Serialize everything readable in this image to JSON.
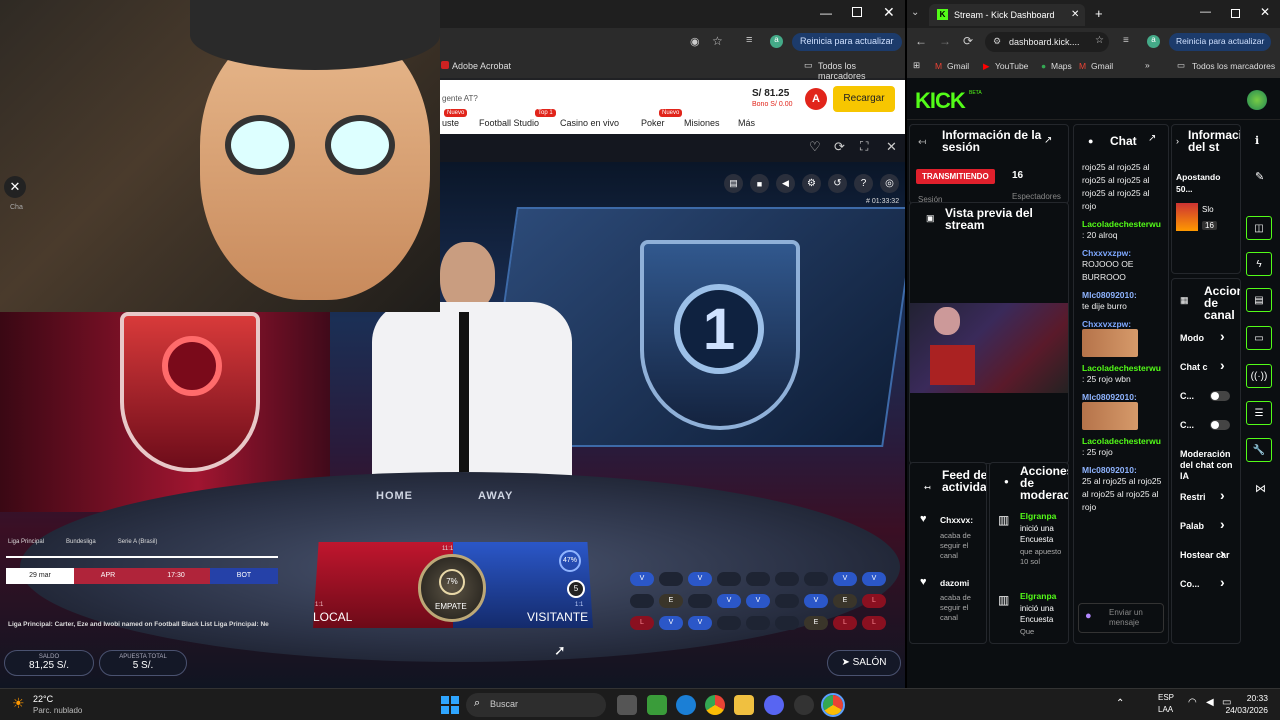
{
  "left_browser": {
    "bookmark": "Adobe Acrobat",
    "all_bookmarks": "Todos los marcadores",
    "restart_label": "Reinicia para actualizar",
    "site": {
      "balance": "S/ 81.25",
      "bonus": "Bono S/ 0.00",
      "avatar_letter": "A",
      "recharge": "Recargar",
      "partial_text": "gente AT?",
      "nav": [
        {
          "label": "Football Studio",
          "badge": "Top 1"
        },
        {
          "label": "Casino en vivo",
          "badge": ""
        },
        {
          "label": "Poker",
          "badge": "Nuevo"
        },
        {
          "label": "Misiones",
          "badge": ""
        },
        {
          "label": "Más",
          "badge": ""
        }
      ],
      "nav_badge_left": "Nuevo",
      "left_fragment": "uste"
    },
    "game": {
      "timer": "# 01:33:32",
      "desk_home": "HOME",
      "desk_away": "AWAY",
      "leagues": [
        "Liga Principal",
        "Bundesliga",
        "Serie A (Brasil)"
      ],
      "date_cells": [
        "29 mar",
        "APR",
        "17:30",
        "BOT"
      ],
      "local": "LOCAL",
      "visitante": "VISITANTE",
      "empate": "EMPATE",
      "empate_pct": "7%",
      "visit_pct": "47%",
      "local_ratio": "1:1",
      "visit_ratio": "1:1",
      "tie_ratio": "11:1",
      "ticker": "Liga Principal: Carter, Eze and Iwobi named on Football Black List   Liga Principal: Ne",
      "saldo_label": "SALDO",
      "saldo": "81,25 S/.",
      "apuesta_label": "APUESTA TOTAL",
      "apuesta": "5 S/.",
      "salon": "SALÓN",
      "history": [
        [
          "V",
          "",
          "V",
          "",
          "",
          "",
          "",
          "V",
          "V"
        ],
        [
          "",
          "E",
          "",
          "V",
          "V",
          "",
          "V",
          "E",
          "L"
        ],
        [
          "L",
          "V",
          "V",
          "",
          "",
          "",
          "E",
          "L",
          "L"
        ]
      ]
    }
  },
  "webcam": {
    "partial_tab": "Cha"
  },
  "right_browser": {
    "tab_title": "Stream - Kick Dashboard",
    "url": "dashboard.kick....",
    "restart_label": "Reinicia para actualizar",
    "bookmarks": [
      "Gmail",
      "YouTube",
      "Maps",
      "Gmail"
    ],
    "all_bookmarks": "Todos los marcadores",
    "logo": "KICK",
    "logo_sup": "BETA",
    "session": {
      "title": "Información de la sesión",
      "status": "TRANSMITIENDO",
      "viewers": "16",
      "viewers_label": "Espectadores",
      "frag": "Sesión"
    },
    "preview": {
      "title": "Vista previa del stream"
    },
    "feed": {
      "title": "Feed de actividad",
      "items": [
        {
          "user": "Chxxvx:",
          "text": "acaba de seguir el canal"
        },
        {
          "user": "dazomi",
          "text": "acaba de seguir el canal"
        }
      ]
    },
    "mod": {
      "title": "Acciones de moderación",
      "items": [
        {
          "user": "Elgranpa",
          "text": "inició una Encuesta",
          "sub": "que apuesto 10 sol"
        },
        {
          "user": "Elgranpa",
          "text": "inició una Encuesta",
          "sub": "Que"
        }
      ]
    },
    "chat": {
      "title": "Chat",
      "messages": [
        {
          "user": "",
          "text": "rojo25 al rojo25 al rojo25 al rojo25 al rojo25 al rojo25 al rojo"
        },
        {
          "user": "Lacoladechesterwu",
          "text": ": 20 alroq"
        },
        {
          "user": "Chxxvxzpw:",
          "text": "ROJOOO OE BURROOO"
        },
        {
          "user": "Mlc08092010:",
          "text": "te dije burro"
        },
        {
          "user": "Chxxvxzpw:",
          "text": ""
        },
        {
          "user": "Lacoladechesterwu",
          "text": ": 25 rojo wbn"
        },
        {
          "user": "Mlc08092010:",
          "text": ""
        },
        {
          "user": "Lacoladechesterwu",
          "text": ": 25 rojo"
        },
        {
          "user": "Mlc08092010:",
          "text": "25 al rojo25 al rojo25 al rojo25 al rojo25 al rojo"
        }
      ],
      "send_placeholder": "Enviar un mensaje"
    },
    "info3": {
      "title": "Información del st",
      "apostando": "Apostando 50...",
      "slot": "Slo",
      "slot_num": "16"
    },
    "actions": {
      "title": "Acciones de canal",
      "items": [
        "Modo",
        "Chat c",
        "C...",
        "C...",
        "Moderación del chat con IA",
        "Restri",
        "Palab",
        "Hostear car",
        "Co..."
      ]
    }
  },
  "taskbar": {
    "temp": "22°C",
    "weather": "Parc. nublado",
    "search": "Buscar",
    "lang": "ESP",
    "lang2": "LAA",
    "time": "20:33",
    "date": "24/03/2026"
  }
}
